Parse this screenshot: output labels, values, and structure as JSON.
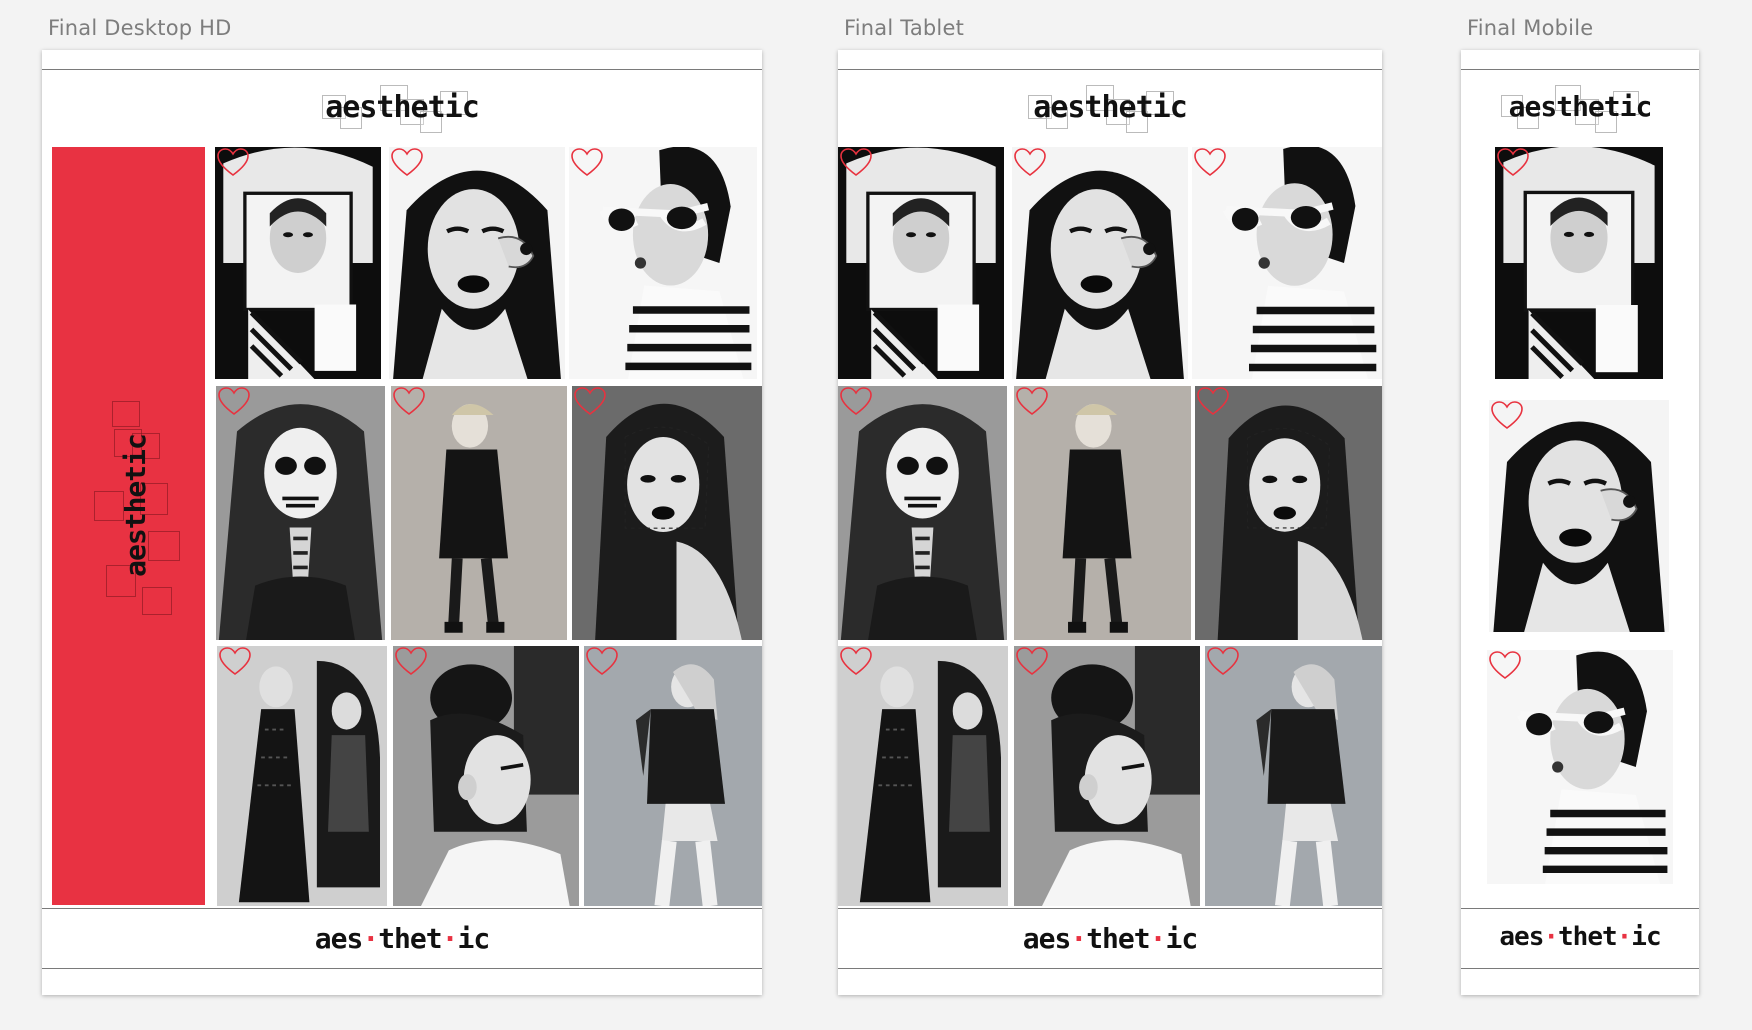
{
  "artboards": {
    "desktop": {
      "label": "Final Desktop HD"
    },
    "tablet": {
      "label": "Final Tablet"
    },
    "mobile": {
      "label": "Final Mobile"
    }
  },
  "brand": {
    "header_logo": "aesthetic",
    "sidebar_logo": "aesthetic",
    "footer_logo_parts": [
      "aes",
      "thet",
      "ic"
    ]
  },
  "colors": {
    "accent": "#e83242",
    "heart": "#e8323f",
    "canvas": "#f3f3f3",
    "artboard": "#ffffff"
  },
  "gallery": {
    "photos": [
      "woman with blonde bob and geometric collage",
      "woman with closed eyes and dark lipstick",
      "woman in white sunglasses and striped top",
      "woman with skull face paint",
      "woman in black dress standing",
      "woman wearing veil",
      "woman in lace gown at mirror",
      "woman with hair bun in profile",
      "woman in leather jacket"
    ],
    "like_icon": "heart-outline-icon"
  }
}
